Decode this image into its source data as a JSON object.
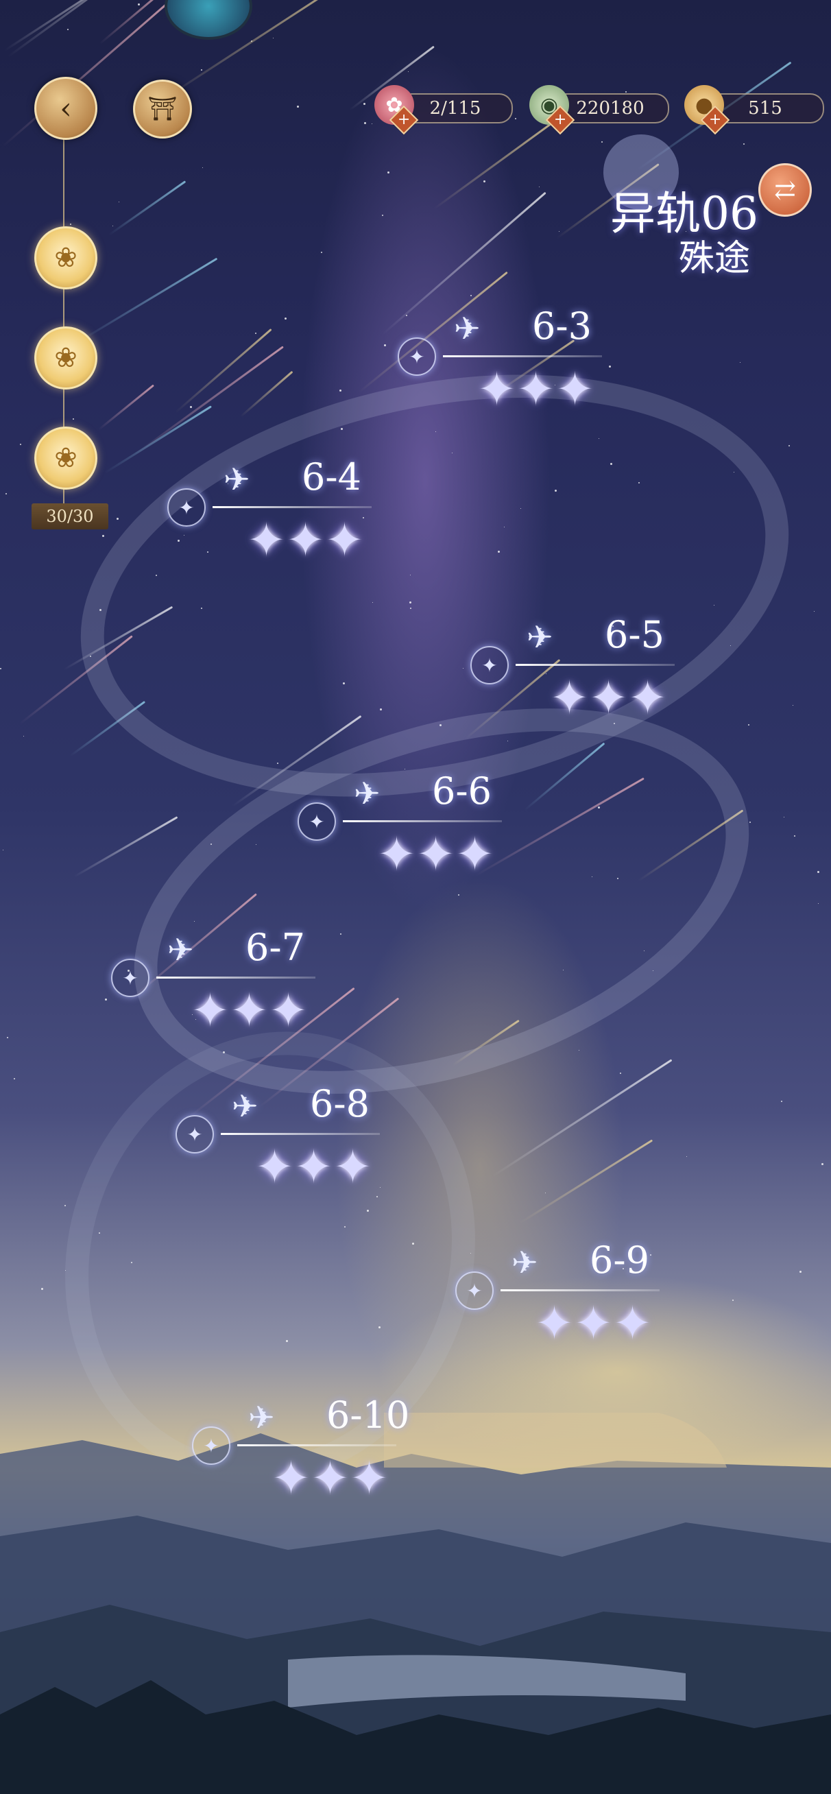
{
  "nav": {
    "back_icon": "back-arrow-icon",
    "home_icon": "shrine-gate-icon",
    "lotus_rewards": [
      "lotus-icon",
      "lotus-icon",
      "lotus-icon"
    ],
    "progress": "30/30"
  },
  "resources": [
    {
      "name": "lotus-currency-icon",
      "value": "2/115"
    },
    {
      "name": "jade-coin-icon",
      "value": "220180"
    },
    {
      "name": "mooncake-icon",
      "value": "515"
    }
  ],
  "chapter": {
    "title": "异轨06",
    "subtitle": "殊途",
    "switch_icon": "swap-arrows-icon"
  },
  "levels": [
    {
      "label": "6-3",
      "stars": "✦✦✦",
      "ring": "✦",
      "emblem": "✈"
    },
    {
      "label": "6-4",
      "stars": "✦✦✦",
      "ring": "✦",
      "emblem": "✈"
    },
    {
      "label": "6-5",
      "stars": "✦✦✦",
      "ring": "✦",
      "emblem": "✈"
    },
    {
      "label": "6-6",
      "stars": "✦✦✦",
      "ring": "✦",
      "emblem": "✈"
    },
    {
      "label": "6-7",
      "stars": "✦✦✦",
      "ring": "✦",
      "emblem": "✈"
    },
    {
      "label": "6-8",
      "stars": "✦✦✦",
      "ring": "✦",
      "emblem": "✈"
    },
    {
      "label": "6-9",
      "stars": "✦✦✦",
      "ring": "✦",
      "emblem": "✈"
    },
    {
      "label": "6-10",
      "stars": "✦✦✦",
      "ring": "✦",
      "emblem": "✈"
    }
  ],
  "star_rating": 3,
  "colors": {
    "accent": "#c3562e",
    "gold": "#e9c98f",
    "star": "#d9d9ff"
  }
}
